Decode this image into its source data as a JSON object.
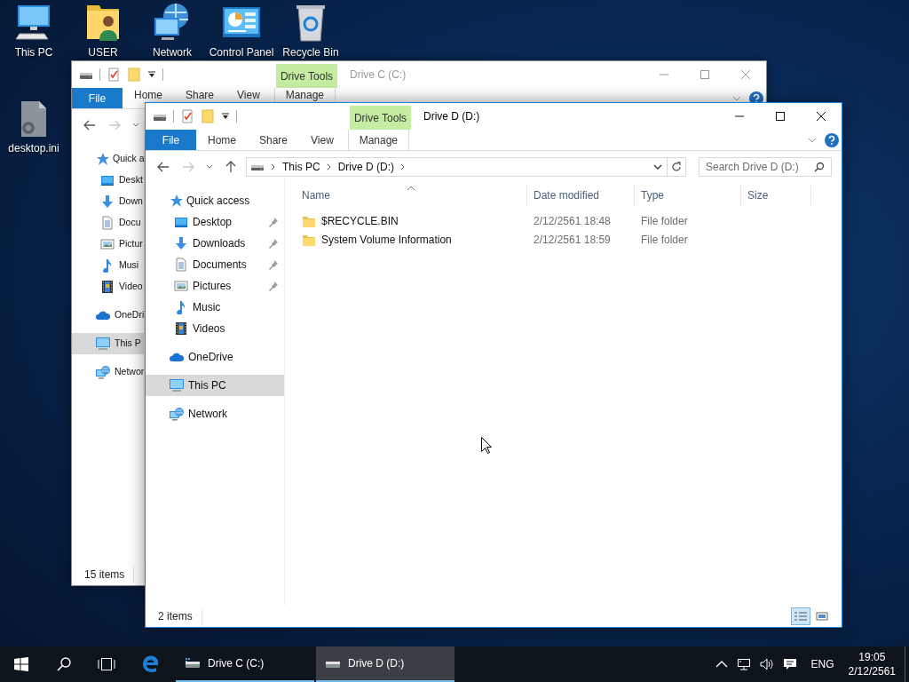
{
  "desktop_icons": [
    {
      "label": "This PC"
    },
    {
      "label": "USER"
    },
    {
      "label": "Network"
    },
    {
      "label": "Control Panel"
    },
    {
      "label": "Recycle Bin"
    },
    {
      "label": "desktop.ini"
    }
  ],
  "windows": [
    {
      "title": "Drive C (C:)",
      "contextual_group": "Drive Tools",
      "ribbon_tabs": [
        {
          "label": "File",
          "kind": "file"
        },
        {
          "label": "Home",
          "kind": "tab"
        },
        {
          "label": "Share",
          "kind": "tab"
        },
        {
          "label": "View",
          "kind": "tab"
        },
        {
          "label": "Manage",
          "kind": "contextual"
        }
      ],
      "nav": [
        {
          "label": "Quick a",
          "selected": false,
          "children": [
            {
              "label": "Deskt",
              "selected": false
            },
            {
              "label": "Down",
              "selected": false
            },
            {
              "label": "Docu",
              "selected": false
            },
            {
              "label": "Pictur",
              "selected": false
            },
            {
              "label": "Musi",
              "selected": false
            },
            {
              "label": "Video",
              "selected": false
            }
          ]
        },
        {
          "label": "OneDri",
          "selected": false
        },
        {
          "label": "This P",
          "selected": true
        },
        {
          "label": "Networ",
          "selected": false
        }
      ],
      "status": "15 items"
    },
    {
      "title": "Drive D (D:)",
      "contextual_group": "Drive Tools",
      "ribbon_tabs": [
        {
          "label": "File",
          "kind": "file"
        },
        {
          "label": "Home",
          "kind": "tab"
        },
        {
          "label": "Share",
          "kind": "tab"
        },
        {
          "label": "View",
          "kind": "tab"
        },
        {
          "label": "Manage",
          "kind": "contextual"
        }
      ],
      "breadcrumb": [
        "This PC",
        "Drive D (D:)"
      ],
      "search": {
        "placeholder": "Search Drive D (D:)"
      },
      "nav": [
        {
          "label": "Quick access",
          "selected": false,
          "children": [
            {
              "label": "Desktop",
              "selected": false,
              "pinned": true
            },
            {
              "label": "Downloads",
              "selected": false,
              "pinned": true
            },
            {
              "label": "Documents",
              "selected": false,
              "pinned": true
            },
            {
              "label": "Pictures",
              "selected": false,
              "pinned": true
            },
            {
              "label": "Music",
              "selected": false,
              "pinned": false
            },
            {
              "label": "Videos",
              "selected": false,
              "pinned": false
            }
          ]
        },
        {
          "label": "OneDrive",
          "selected": false
        },
        {
          "label": "This PC",
          "selected": true
        },
        {
          "label": "Network",
          "selected": false
        }
      ],
      "columns": [
        {
          "label": "Name",
          "sorted": true
        },
        {
          "label": "Date modified",
          "sorted": false
        },
        {
          "label": "Type",
          "sorted": false
        },
        {
          "label": "Size",
          "sorted": false
        }
      ],
      "rows": [
        {
          "name": "$RECYCLE.BIN",
          "date_modified": "2/12/2561 18:48",
          "type": "File folder"
        },
        {
          "name": "System Volume Information",
          "date_modified": "2/12/2561 18:59",
          "type": "File folder"
        }
      ],
      "status": "2 items"
    }
  ],
  "taskbar": {
    "items": [
      {
        "label": "Drive C (C:)",
        "active": false
      },
      {
        "label": "Drive D (D:)",
        "active": true
      }
    ],
    "language": "ENG",
    "time": "19:05",
    "date": "2/12/2561"
  }
}
